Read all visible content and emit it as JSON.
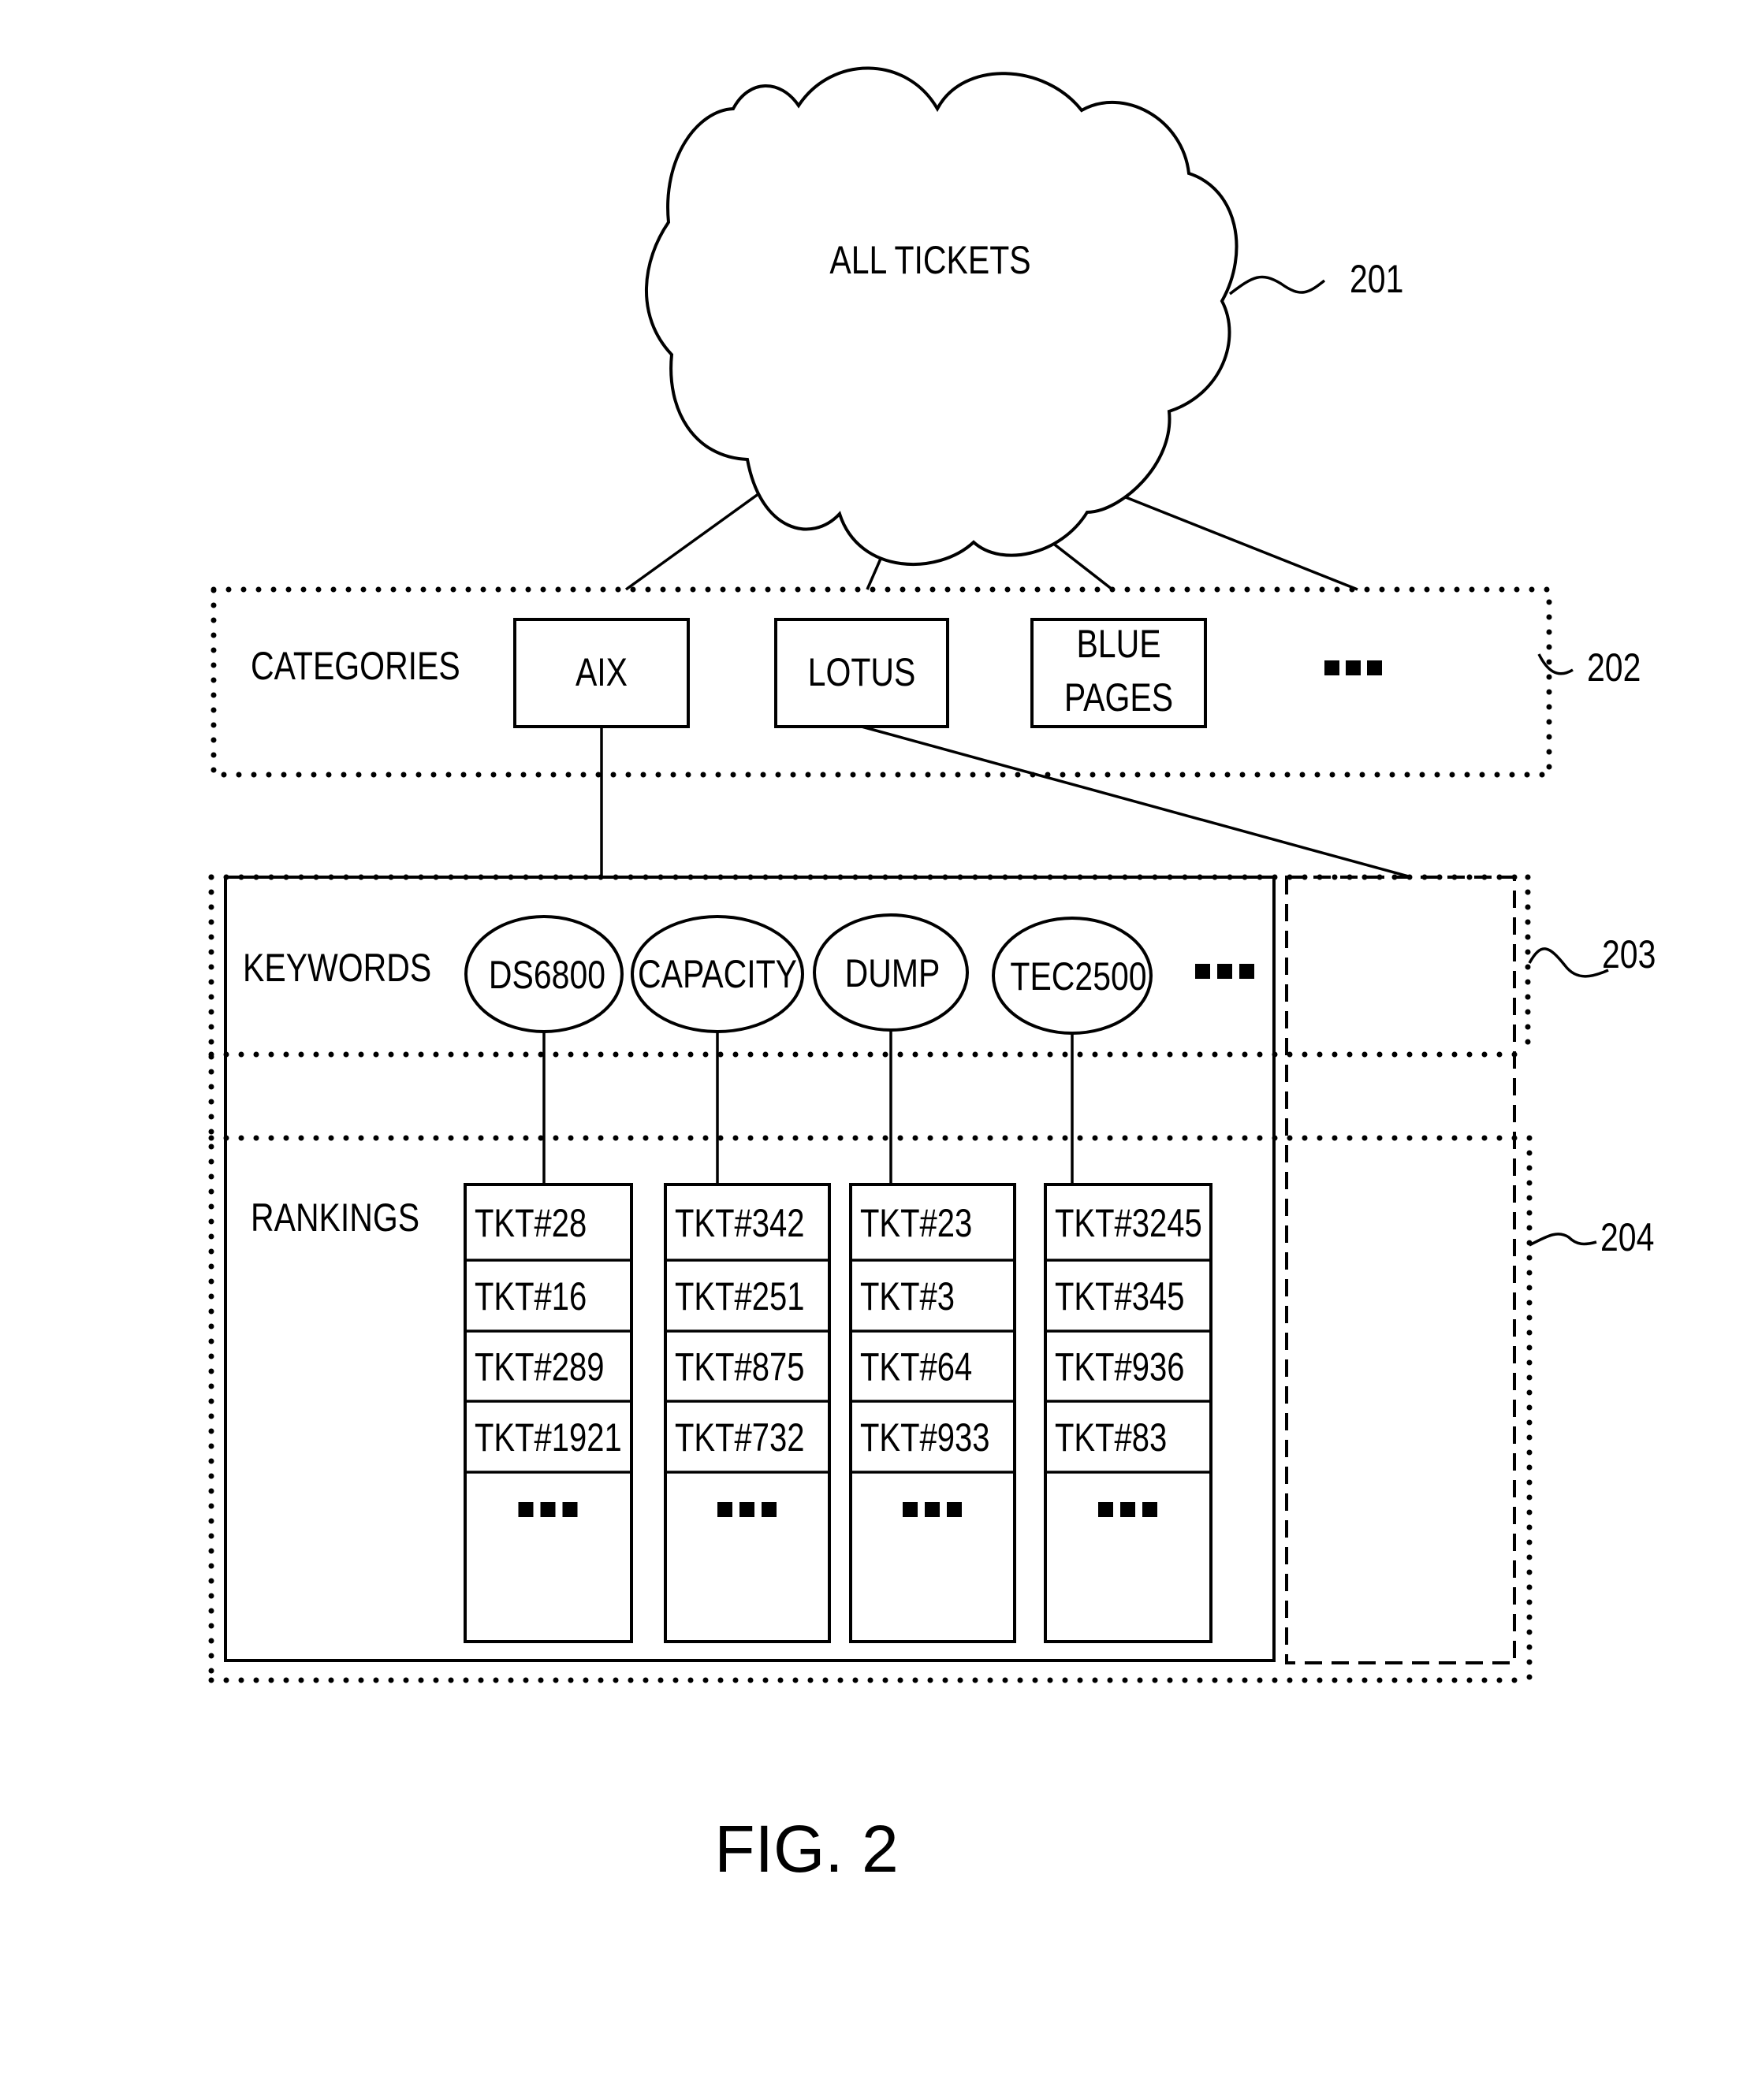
{
  "figure": {
    "caption": "FIG. 2",
    "cloud": {
      "label": "ALL TICKETS",
      "ref": "201"
    },
    "categories": {
      "heading": "CATEGORIES",
      "ref": "202",
      "items": [
        {
          "label_lines": [
            "AIX"
          ]
        },
        {
          "label_lines": [
            "LOTUS"
          ]
        },
        {
          "label_lines": [
            "BLUE",
            "PAGES"
          ]
        }
      ],
      "more": "..."
    },
    "keywords": {
      "heading": "KEYWORDS",
      "ref": "203",
      "items": [
        "DS6800",
        "CAPACITY",
        "DUMP",
        "TEC2500"
      ],
      "more": "..."
    },
    "rankings": {
      "heading": "RANKINGS",
      "ref": "204",
      "columns": [
        [
          "TKT#28",
          "TKT#16",
          "TKT#289",
          "TKT#1921"
        ],
        [
          "TKT#342",
          "TKT#251",
          "TKT#875",
          "TKT#732"
        ],
        [
          "TKT#23",
          "TKT#3",
          "TKT#64",
          "TKT#933"
        ],
        [
          "TKT#3245",
          "TKT#345",
          "TKT#936",
          "TKT#83"
        ]
      ],
      "more": "..."
    }
  }
}
